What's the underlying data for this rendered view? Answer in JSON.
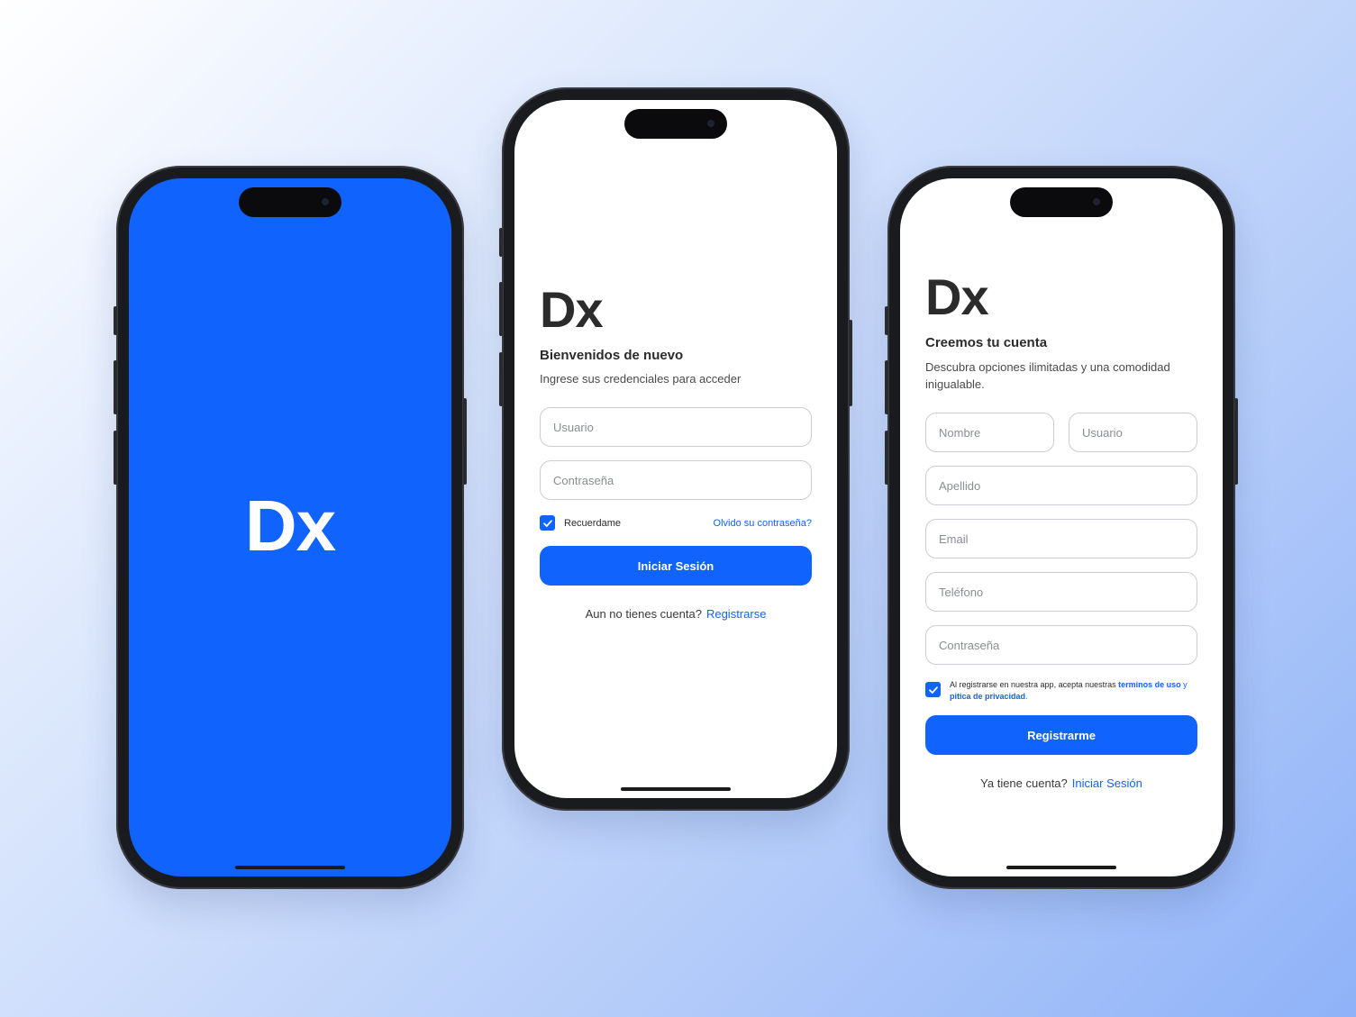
{
  "splash": {
    "logo": "Dx",
    "background_color": "#1163fe"
  },
  "login": {
    "logo": "Dx",
    "title": "Bienvenidos de nuevo",
    "subtitle": "Ingrese sus credenciales para acceder",
    "username_placeholder": "Usuario",
    "password_placeholder": "Contraseña",
    "remember_label": "Recuerdame",
    "remember_checked": true,
    "forgot_link": "Olvido su contraseña?",
    "submit_label": "Iniciar Sesión",
    "footer_text": "Aun no tienes cuenta?",
    "footer_link": "Registrarse"
  },
  "register": {
    "logo": "Dx",
    "title": "Creemos tu cuenta",
    "subtitle": "Descubra opciones ilimitadas y una comodidad inigualable.",
    "name_placeholder": "Nombre",
    "username_placeholder": "Usuario",
    "lastname_placeholder": "Apellido",
    "email_placeholder": "Email",
    "phone_placeholder": "Teléfono",
    "password_placeholder": "Contraseña",
    "terms_checked": true,
    "terms_prefix": "Al  registrarse en nuestra app, acepta nuestras",
    "terms_link": "terminos de uso",
    "terms_and": "y",
    "privacy_link": "pitica de privacidad",
    "terms_suffix": ".",
    "submit_label": "Registrarme",
    "footer_text": "Ya tiene cuenta?",
    "footer_link": "Iniciar Sesión"
  },
  "colors": {
    "accent": "#1163fe",
    "text_dark": "#2b2b2b",
    "border": "#c9ccd2"
  }
}
